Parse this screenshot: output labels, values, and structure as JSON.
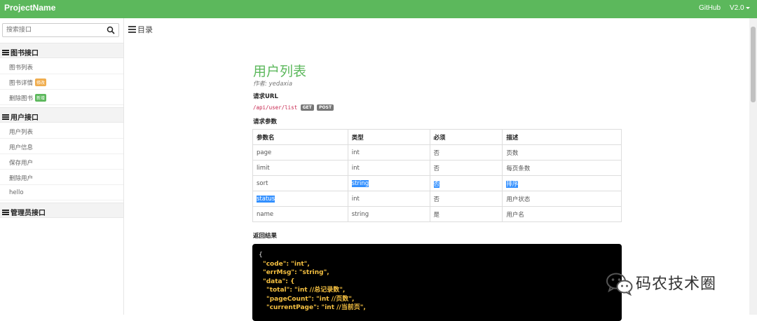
{
  "header": {
    "brand": "ProjectName",
    "github_label": "GitHub",
    "version_label": "V2.0"
  },
  "sidebar": {
    "search_placeholder": "搜索接口",
    "groups": [
      {
        "title": "图书接口",
        "items": [
          {
            "label": "图书列表"
          },
          {
            "label": "图书详情",
            "badge": "修改"
          },
          {
            "label": "删除图书",
            "badge": "新增"
          }
        ]
      },
      {
        "title": "用户接口",
        "items": [
          {
            "label": "用户列表"
          },
          {
            "label": "用户信息"
          },
          {
            "label": "保存用户"
          },
          {
            "label": "删除用户"
          },
          {
            "label": "hello"
          }
        ]
      },
      {
        "title": "管理员接口",
        "items": []
      }
    ]
  },
  "toc": {
    "label": "目录"
  },
  "doc": {
    "title": "用户列表",
    "author": "作者: yedaxia",
    "request_url_label": "请求URL",
    "url": "/api/user/list",
    "methods": [
      "GET",
      "POST"
    ],
    "params_label": "请求参数",
    "params_headers": [
      "参数名",
      "类型",
      "必须",
      "描述"
    ],
    "params_rows": [
      [
        "page",
        "int",
        "否",
        "页数"
      ],
      [
        "limit",
        "int",
        "否",
        "每页条数"
      ],
      [
        "sort",
        "string",
        "否",
        "排序"
      ],
      [
        "status",
        "int",
        "否",
        "用户状态"
      ],
      [
        "name",
        "string",
        "是",
        "用户名"
      ]
    ],
    "response_label": "返回结果",
    "code": {
      "open": "{",
      "l1": "\"code\": \"int\",",
      "l2": "\"errMsg\": \"string\",",
      "l3": "\"data\": {",
      "l4": "\"total\": \"int //总记录数\",",
      "l5": "\"pageCount\": \"int //页数\",",
      "l6": "\"currentPage\": \"int //当前页\","
    }
  },
  "watermark": {
    "text": "码农技术圈"
  },
  "colors": {
    "accent": "#5cb85c",
    "badge_orange": "#f0ad4e",
    "selection": "#3390ff"
  }
}
